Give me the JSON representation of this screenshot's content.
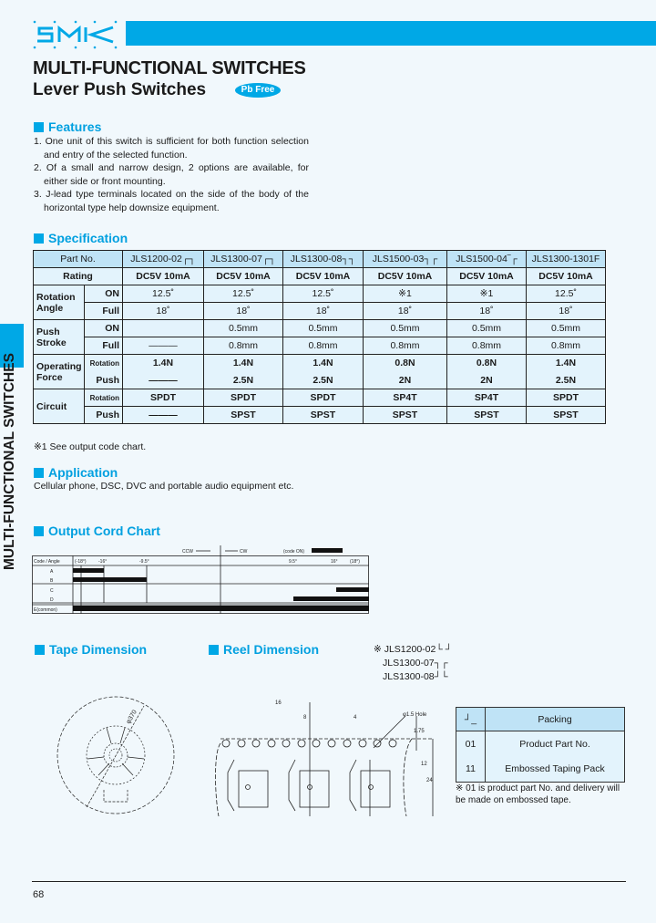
{
  "header": {
    "logo": "SMK",
    "title": "MULTI-FUNCTIONAL SWITCHES",
    "subtitle": "Lever Push Switches",
    "badge": "Pb Free",
    "side_tab": "MULTI-FUNCTIONAL SWITCHES"
  },
  "features": {
    "heading": "Features",
    "items": [
      "1. One unit of this switch is sufficient for both function selection and entry of the selected function.",
      "2. Of a small and narrow design, 2 options are available, for either side or front mounting.",
      "3. J-lead type terminals located on the side of the body of the horizontal type help downsize equipment."
    ]
  },
  "specification": {
    "heading": "Specification",
    "part_no_label": "Part No.",
    "parts": [
      "JLS1200-02┌┐",
      "JLS1300-07┌┐",
      "JLS1300-08┐┐",
      "JLS1500-03┐┌",
      "JLS1500-04‾┌",
      "JLS1300-1301F"
    ],
    "rows": {
      "rating": {
        "label": "Rating",
        "values": [
          "DC5V 10mA",
          "DC5V 10mA",
          "DC5V 10mA",
          "DC5V 10mA",
          "DC5V 10mA",
          "DC5V 10mA"
        ]
      },
      "rotation_angle": {
        "label": "Rotation Angle",
        "on": {
          "label": "ON",
          "values": [
            "12.5˚",
            "12.5˚",
            "12.5˚",
            "※1",
            "※1",
            "12.5˚"
          ]
        },
        "full": {
          "label": "Full",
          "values": [
            "18˚",
            "18˚",
            "18˚",
            "18˚",
            "18˚",
            "18˚"
          ]
        }
      },
      "push_stroke": {
        "label": "Push Stroke",
        "on": {
          "label": "ON",
          "values": [
            "",
            "0.5mm",
            "0.5mm",
            "0.5mm",
            "0.5mm",
            "0.5mm"
          ]
        },
        "full": {
          "label": "Full",
          "values": [
            "———",
            "0.8mm",
            "0.8mm",
            "0.8mm",
            "0.8mm",
            "0.8mm"
          ]
        }
      },
      "operating_force": {
        "label": "Operating Force",
        "rotation": {
          "label": "Rotation",
          "values": [
            "1.4N",
            "1.4N",
            "1.4N",
            "0.8N",
            "0.8N",
            "1.4N"
          ]
        },
        "push": {
          "label": "Push",
          "values": [
            "———",
            "2.5N",
            "2.5N",
            "2N",
            "2N",
            "2.5N"
          ]
        }
      },
      "circuit": {
        "label": "Circuit",
        "rotation": {
          "label": "Rotation",
          "values": [
            "SPDT",
            "SPDT",
            "SPDT",
            "SP4T",
            "SP4T",
            "SPDT"
          ]
        },
        "push": {
          "label": "Push",
          "values": [
            "———",
            "SPST",
            "SPST",
            "SPST",
            "SPST",
            "SPST"
          ]
        }
      }
    },
    "footnote": "※1  See output code chart."
  },
  "application": {
    "heading": "Application",
    "text": "Cellular phone, DSC, DVC and portable audio equipment etc."
  },
  "output_chart": {
    "heading": "Output Cord Chart",
    "legend_ccw": "CCW",
    "legend_cw": "CW",
    "legend_code_on": "(code ON)",
    "corner_label": "Code / Angle",
    "angle_labels": [
      "(-18°)",
      "-16°",
      "-9.5°",
      "9.5°",
      "16°",
      "(18°)"
    ],
    "rows": [
      "A",
      "B",
      "C",
      "D",
      "E(common)"
    ]
  },
  "tape_dimension": {
    "heading": "Tape Dimension"
  },
  "reel_dimension": {
    "heading": "Reel Dimension",
    "diameter_label": "φ370",
    "pitch_labels": [
      "16",
      "8",
      "4",
      "φ1.5 Hole",
      "1.75",
      "12",
      "24"
    ]
  },
  "models_note": [
    "※ JLS1200-02└ ┘",
    "JLS1300-07┐┌",
    "JLS1300-08┘└"
  ],
  "packing": {
    "header_code": "┘_",
    "header_label": "Packing",
    "rows": [
      {
        "code": "01",
        "label": "Product Part No."
      },
      {
        "code": "11",
        "label": "Embossed Taping Pack"
      }
    ],
    "note": "※ 01 is product part No. and delivery will be made on embossed tape."
  },
  "footer": {
    "page_number": "68"
  },
  "colors": {
    "accent": "#00a8e6",
    "table_header": "#bfe3f6",
    "table_cell": "#e3f3fc",
    "background": "#f1f8fc"
  }
}
